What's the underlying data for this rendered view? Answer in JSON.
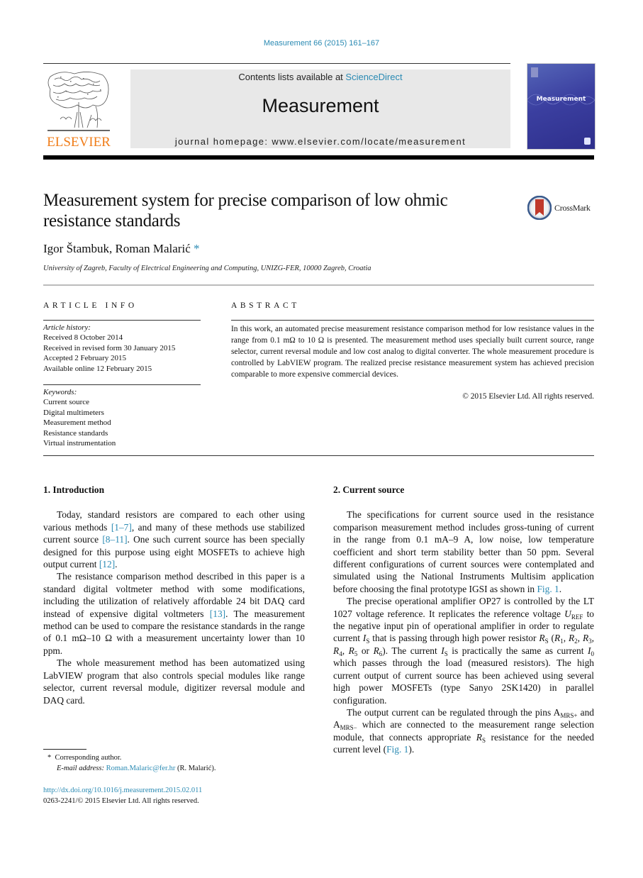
{
  "header": {
    "citation": "Measurement 66 (2015) 161–167",
    "contents_prefix": "Contents lists available at ",
    "contents_link": "ScienceDirect",
    "journal_name": "Measurement",
    "homepage": "journal homepage: www.elsevier.com/locate/measurement",
    "publisher_logo_text": "ELSEVIER",
    "cover_title": "Measurement",
    "colors": {
      "link": "#2a8ab3",
      "elsevier_orange": "#f07d1a",
      "cover_blue": "#3b3fa0",
      "banner_gray": "#e8e8e8"
    }
  },
  "article": {
    "title": "Measurement system for precise comparison of low ohmic resistance standards",
    "crossmark_label": "CrossMark",
    "authors": "Igor Štambuk, Roman Malarić",
    "corresponding_marker": "*",
    "affiliation": "University of Zagreb, Faculty of Electrical Engineering and Computing, UNIZG-FER, 10000 Zagreb, Croatia"
  },
  "article_info": {
    "heading": "ARTICLE INFO",
    "history_label": "Article history:",
    "history": [
      "Received 8 October 2014",
      "Received in revised form 30 January 2015",
      "Accepted 2 February 2015",
      "Available online 12 February 2015"
    ],
    "keywords_label": "Keywords:",
    "keywords": [
      "Current source",
      "Digital multimeters",
      "Measurement method",
      "Resistance standards",
      "Virtual instrumentation"
    ]
  },
  "abstract": {
    "heading": "ABSTRACT",
    "text": "In this work, an automated precise measurement resistance comparison method for low resistance values in the range from 0.1 mΩ to 10 Ω is presented. The measurement method uses specially built current source, range selector, current reversal module and low cost analog to digital converter. The whole measurement procedure is controlled by LabVIEW program. The realized precise resistance measurement system has achieved precision comparable to more expensive commercial devices.",
    "copyright": "© 2015 Elsevier Ltd. All rights reserved."
  },
  "intro": {
    "heading": "1. Introduction",
    "p1": {
      "a": "Today, standard resistors are compared to each other using various methods ",
      "ref1": "[1–7]",
      "b": ", and many of these methods use stabilized current source ",
      "ref2": "[8–11]",
      "c": ". One such current source has been specially designed for this purpose using eight MOSFETs to achieve high output current ",
      "ref3": "[12]",
      "d": "."
    },
    "p2": {
      "a": "The resistance comparison method described in this paper is a standard digital voltmeter method with some modifications, including the utilization of relatively affordable 24 bit DAQ card instead of expensive digital voltmeters ",
      "ref1": "[13]",
      "b": ". The measurement method can be used to compare the resistance standards in the range of 0.1 mΩ–10 Ω with a measurement uncertainty lower than 10 ppm."
    },
    "p3": "The whole measurement method has been automatized using LabVIEW program that also controls special modules like range selector, current reversal module, digitizer reversal module and DAQ card."
  },
  "current_source": {
    "heading": "2. Current source",
    "p1": {
      "a": "The specifications for current source used in the resistance comparison measurement method includes gross-tuning of current in the range from 0.1 mA–9 A, low noise, low temperature coefficient and short term stability better than 50 ppm. Several different configurations of current sources were contemplated and simulated using the National Instruments Multisim application before choosing the final prototype IGSI as shown in ",
      "fig": "Fig. 1",
      "b": "."
    },
    "p2": {
      "a": "The precise operational amplifier OP27 is controlled by the LT 1027 voltage reference. It replicates the reference voltage ",
      "u": "U",
      "u_sub": "REF",
      "b": " to the negative input pin of operational amplifier in order to regulate current ",
      "i": "I",
      "i_sub": "S",
      "c": " that is passing through high power resistor ",
      "r": "R",
      "r_sub": "S",
      "d": " (",
      "r1": "R",
      "r1_sub": "1",
      "sep1": ", ",
      "r2": "R",
      "r2_sub": "2",
      "sep2": ", ",
      "r3": "R",
      "r3_sub": "3",
      "sep3": ", ",
      "r4": "R",
      "r4_sub": "4",
      "sep4": ", ",
      "r5": "R",
      "r5_sub": "5",
      "or": " or ",
      "r6": "R",
      "r6_sub": "6",
      "e": "). The current ",
      "is2": "I",
      "is2_sub": "S",
      "f": " is practically the same as current ",
      "i0": "I",
      "i0_sub": "0",
      "g": " which passes through the load (measured resistors). The high current output of current source has been achieved using several high power MOSFETs (type Sanyo 2SK1420) in parallel configuration."
    },
    "p3": {
      "a": "The output current can be regulated through the pins ",
      "amrs_plus": "A",
      "amrs_plus_sub": "MRS+",
      "b": " and ",
      "amrs_minus": "A",
      "amrs_minus_sub": "MRS−",
      "c": " which are connected to the measurement range selection module, that connects appropriate ",
      "rs": "R",
      "rs_sub": "S",
      "d": " resistance for the needed current level (",
      "fig": "Fig. 1",
      "e": ")."
    }
  },
  "footnote": {
    "marker": "*",
    "corresponding": "Corresponding author.",
    "email_label": "E-mail address:",
    "email": "Roman.Malaric@fer.hr",
    "email_owner": " (R. Malarić).",
    "doi": "http://dx.doi.org/10.1016/j.measurement.2015.02.011",
    "issn_line": "0263-2241/© 2015 Elsevier Ltd. All rights reserved."
  }
}
